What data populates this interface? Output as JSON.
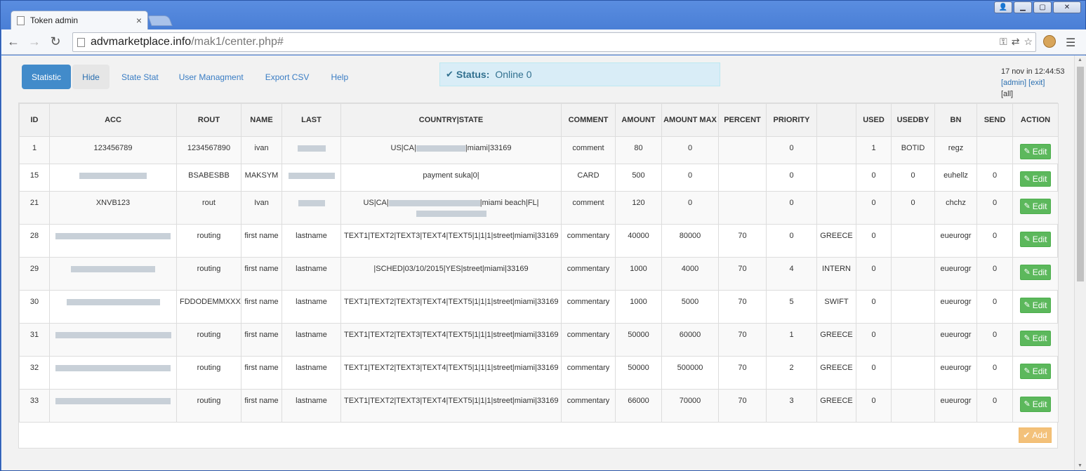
{
  "browser": {
    "tab_title": "Token admin",
    "tab_close": "×",
    "url_host": "advmarketplace.info",
    "url_path": "/mak1/center.php#"
  },
  "nav": {
    "statistic": "Statistic",
    "hide": "Hide",
    "state_stat": "State Stat",
    "user_managment": "User Managment",
    "export_csv": "Export CSV",
    "help": "Help"
  },
  "status": {
    "label": "Status:",
    "value": "Online 0"
  },
  "user": {
    "datetime": "17 nov in 12:44:53",
    "admin": "[admin]",
    "exit": "[exit]",
    "all": "[all]"
  },
  "table": {
    "headers": [
      "ID",
      "ACC",
      "ROUT",
      "NAME",
      "LAST",
      "COUNTRY|STATE",
      "COMMENT",
      "AMOUNT",
      "AMOUNT MAX",
      "PERCENT",
      "PRIORITY",
      "",
      "USED",
      "USEDBY",
      "BN",
      "SEND",
      "ACTION"
    ],
    "edit_label": "Edit",
    "rows": [
      {
        "id": "1",
        "acc": "123456789",
        "rout": "1234567890",
        "name": "ivan",
        "last": "",
        "country_a": "US|CA|",
        "country_b": "|miami|33169",
        "comment": "comment",
        "amount": "80",
        "amount_max": "0",
        "percent": "",
        "priority": "0",
        "type": "",
        "used": "1",
        "usedby": "BOTID",
        "bn": "regz",
        "send": ""
      },
      {
        "id": "15",
        "acc": "",
        "rout": "BSABESBB",
        "name": "MAKSYM",
        "last": "",
        "country_a": "payment suka|0|",
        "country_b": "",
        "comment": "CARD",
        "amount": "500",
        "amount_max": "0",
        "percent": "",
        "priority": "0",
        "type": "",
        "used": "0",
        "usedby": "0",
        "bn": "euhellz",
        "send": "0"
      },
      {
        "id": "21",
        "acc": "XNVB123",
        "rout": "rout",
        "name": "Ivan",
        "last": "",
        "country_a": "US|CA|",
        "country_b": "|miami beach|FL|",
        "comment": "comment",
        "amount": "120",
        "amount_max": "0",
        "percent": "",
        "priority": "0",
        "type": "",
        "used": "0",
        "usedby": "0",
        "bn": "chchz",
        "send": "0"
      },
      {
        "id": "28",
        "acc": "",
        "rout": "routing",
        "name": "first name",
        "last": "lastname",
        "country_a": "TEXT1|TEXT2|TEXT3|TEXT4|TEXT5|1|1|1|street|miami|33169",
        "country_b": "",
        "comment": "commentary",
        "amount": "40000",
        "amount_max": "80000",
        "percent": "70",
        "priority": "0",
        "type": "GREECE",
        "used": "0",
        "usedby": "",
        "bn": "eueurogr",
        "send": "0"
      },
      {
        "id": "29",
        "acc": "",
        "rout": "routing",
        "name": "first name",
        "last": "lastname",
        "country_a": "|SCHED|03/10/2015|YES|street|miami|33169",
        "country_b": "",
        "comment": "commentary",
        "amount": "1000",
        "amount_max": "4000",
        "percent": "70",
        "priority": "4",
        "type": "INTERN",
        "used": "0",
        "usedby": "",
        "bn": "eueurogr",
        "send": "0"
      },
      {
        "id": "30",
        "acc": "",
        "rout": "FDDODEMMXXX",
        "name": "first name",
        "last": "lastname",
        "country_a": "TEXT1|TEXT2|TEXT3|TEXT4|TEXT5|1|1|1|street|miami|33169",
        "country_b": "",
        "comment": "commentary",
        "amount": "1000",
        "amount_max": "5000",
        "percent": "70",
        "priority": "5",
        "type": "SWIFT",
        "used": "0",
        "usedby": "",
        "bn": "eueurogr",
        "send": "0"
      },
      {
        "id": "31",
        "acc": "",
        "rout": "routing",
        "name": "first name",
        "last": "lastname",
        "country_a": "TEXT1|TEXT2|TEXT3|TEXT4|TEXT5|1|1|1|street|miami|33169",
        "country_b": "",
        "comment": "commentary",
        "amount": "50000",
        "amount_max": "60000",
        "percent": "70",
        "priority": "1",
        "type": "GREECE",
        "used": "0",
        "usedby": "",
        "bn": "eueurogr",
        "send": "0"
      },
      {
        "id": "32",
        "acc": "",
        "rout": "routing",
        "name": "first name",
        "last": "lastname",
        "country_a": "TEXT1|TEXT2|TEXT3|TEXT4|TEXT5|1|1|1|street|miami|33169",
        "country_b": "",
        "comment": "commentary",
        "amount": "50000",
        "amount_max": "500000",
        "percent": "70",
        "priority": "2",
        "type": "GREECE",
        "used": "0",
        "usedby": "",
        "bn": "eueurogr",
        "send": "0"
      },
      {
        "id": "33",
        "acc": "",
        "rout": "routing",
        "name": "first name",
        "last": "lastname",
        "country_a": "TEXT1|TEXT2|TEXT3|TEXT4|TEXT5|1|1|1|street|miami|33169",
        "country_b": "",
        "comment": "commentary",
        "amount": "66000",
        "amount_max": "70000",
        "percent": "70",
        "priority": "3",
        "type": "GREECE",
        "used": "0",
        "usedby": "",
        "bn": "eueurogr",
        "send": "0"
      }
    ]
  },
  "add_label": "Add"
}
